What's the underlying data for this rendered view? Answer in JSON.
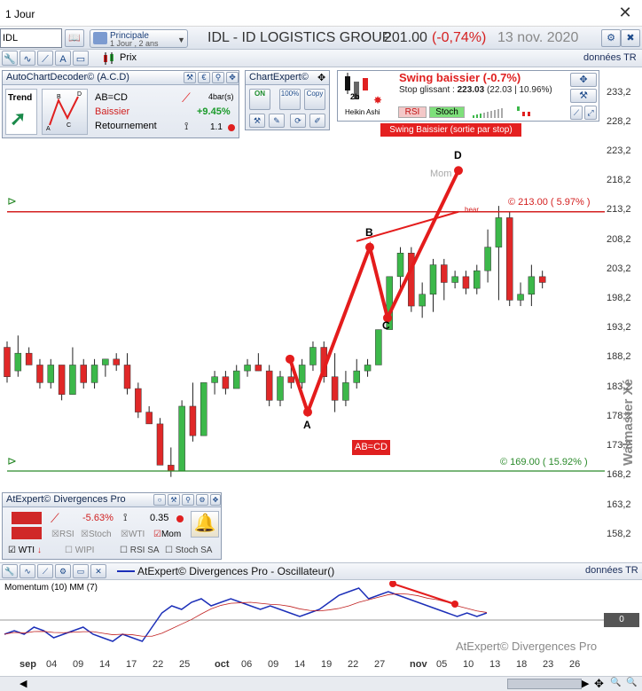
{
  "window": {
    "title": "1 Jour"
  },
  "toolbar": {
    "symbol": "IDL",
    "period_line1": "Principale",
    "period_line2": "1 Jour , 2 ans",
    "stock_title": "IDL - ID LOGISTICS GROUP",
    "price": "201.00",
    "change": "(-0,74%)",
    "date": "13 nov. 2020",
    "prix_label": "Prix",
    "donnees": "données TR"
  },
  "acd": {
    "title": "AutoChartDecoder© (A.C.D)",
    "trend_label": "Trend",
    "pattern": "AB=CD",
    "direction": "Baissier",
    "state": "Retournement",
    "bars": "4bar(s)",
    "pct": "+9.45%",
    "ratio": "1.1"
  },
  "chartexpert": {
    "title": "ChartExpert©",
    "on": "ON",
    "pct100": "100%",
    "copy": "Copy"
  },
  "swing": {
    "title": "Swing baissier (-0.7%)",
    "stop_prefix": "Stop glissant : ",
    "stop_value": "223.03",
    "stop_detail": "(22.03 | 10.96%)",
    "heikin": "Heikin Ashi",
    "twob": "2b",
    "rsi": "RSI",
    "stoch": "Stoch",
    "sortie": "Swing Baissier (sortie par stop)"
  },
  "chart_annotations": {
    "level_high": "© 213.00 ( 5.97% )",
    "level_low": "© 169.00 ( 15.92% )",
    "abcd_box": "AB=CD",
    "point_a": "A",
    "point_b": "B",
    "point_c": "C",
    "point_d": "D",
    "mom_label": "Mom",
    "bear_label": "bear"
  },
  "yaxis": [
    "233,2",
    "228,2",
    "223,2",
    "218,2",
    "213,2",
    "208,2",
    "203,2",
    "198,2",
    "193,2",
    "188,2",
    "183,2",
    "178,2",
    "173,2",
    "168,2",
    "163,2",
    "158,2"
  ],
  "xaxis": [
    "sep",
    "04",
    "09",
    "14",
    "17",
    "22",
    "25",
    "oct",
    "06",
    "09",
    "14",
    "19",
    "22",
    "27",
    "nov",
    "05",
    "10",
    "13",
    "18",
    "23",
    "26"
  ],
  "divergences": {
    "title": "AtExpert© Divergences Pro",
    "pct": "-5.63%",
    "value": "0.35",
    "wti": "WTI",
    "wipi": "WIPI",
    "rsi": "RSI",
    "stoch": "Stoch",
    "wti2": "WTI",
    "mom": "Mom",
    "rsi_sa": "RSI SA",
    "stoch_sa": "Stoch SA"
  },
  "oscillator": {
    "title": "AtExpert© Divergences Pro - Oscillateur()",
    "donnees": "données TR",
    "label": "Momentum (10) MM (7)",
    "watermark": "AtExpert© Divergences Pro",
    "value": "0"
  },
  "branding": "Walmaster Xé",
  "colors": {
    "up": "#3cb84a",
    "down": "#e02828",
    "pattern": "#e41c1c",
    "osc": "#1c2fb8"
  },
  "chart_data": {
    "type": "candlestick",
    "ylim": [
      155,
      236
    ],
    "levels": [
      213.0,
      169.0
    ],
    "candles": [
      [
        190,
        191,
        184,
        185
      ],
      [
        186,
        192,
        185,
        189
      ],
      [
        189,
        190,
        187,
        187
      ],
      [
        187,
        188,
        183,
        184
      ],
      [
        184,
        188,
        183,
        187
      ],
      [
        187,
        187,
        181,
        182
      ],
      [
        182,
        190,
        182,
        187
      ],
      [
        187,
        188,
        183,
        184
      ],
      [
        184,
        188,
        183,
        187
      ],
      [
        187,
        188,
        185,
        188
      ],
      [
        188,
        189,
        186,
        187
      ],
      [
        187,
        189,
        182,
        183
      ],
      [
        183,
        184,
        178,
        179
      ],
      [
        179,
        180,
        177,
        177
      ],
      [
        177,
        178,
        170,
        170
      ],
      [
        170,
        173,
        168,
        169
      ],
      [
        169,
        181,
        169,
        180
      ],
      [
        180,
        184,
        174,
        175
      ],
      [
        175,
        184,
        175,
        184
      ],
      [
        184,
        186,
        182,
        185
      ],
      [
        185,
        186,
        182,
        183
      ],
      [
        183,
        187,
        183,
        186
      ],
      [
        186,
        188,
        185,
        187
      ],
      [
        187,
        189,
        186,
        186
      ],
      [
        186,
        187,
        180,
        181
      ],
      [
        181,
        186,
        180,
        185
      ],
      [
        185,
        187,
        183,
        184
      ],
      [
        184,
        188,
        183,
        187
      ],
      [
        187,
        191,
        186,
        190
      ],
      [
        190,
        191,
        184,
        185
      ],
      [
        185,
        189,
        179,
        181
      ],
      [
        181,
        186,
        180,
        184
      ],
      [
        184,
        188,
        183,
        186
      ],
      [
        186,
        188,
        185,
        187
      ],
      [
        187,
        193,
        187,
        193
      ],
      [
        193,
        202,
        193,
        202
      ],
      [
        202,
        207,
        200,
        206
      ],
      [
        206,
        207,
        196,
        197
      ],
      [
        197,
        201,
        195,
        199
      ],
      [
        199,
        205,
        196,
        204
      ],
      [
        204,
        205,
        198,
        201
      ],
      [
        201,
        203,
        200,
        202
      ],
      [
        202,
        203,
        199,
        200
      ],
      [
        200,
        204,
        199,
        203
      ],
      [
        203,
        210,
        201,
        207
      ],
      [
        207,
        214,
        198,
        212
      ],
      [
        212,
        213,
        197,
        198
      ],
      [
        198,
        201,
        197,
        199
      ],
      [
        199,
        204,
        197,
        202
      ],
      [
        202,
        203,
        200,
        201
      ]
    ],
    "pattern_points": [
      {
        "label": "A",
        "x": "oct 15",
        "y": 179.0
      },
      {
        "label": "B",
        "x": "oct 23",
        "y": 207.0
      },
      {
        "label": "C",
        "x": "oct 28",
        "y": 195.0
      },
      {
        "label": "D",
        "x": "nov 09",
        "y": 220.0
      }
    ],
    "momentum": [
      -4,
      -3,
      -4,
      -2,
      -3,
      -5,
      -4,
      -3,
      -2,
      -4,
      -5,
      -6,
      -4,
      -5,
      -6,
      -2,
      2,
      4,
      3,
      5,
      6,
      4,
      5,
      6,
      5,
      4,
      3,
      4,
      3,
      2,
      1,
      2,
      3,
      5,
      7,
      8,
      9,
      6,
      7,
      8,
      7,
      6,
      5,
      4,
      3,
      2,
      1,
      2,
      1,
      2
    ]
  }
}
